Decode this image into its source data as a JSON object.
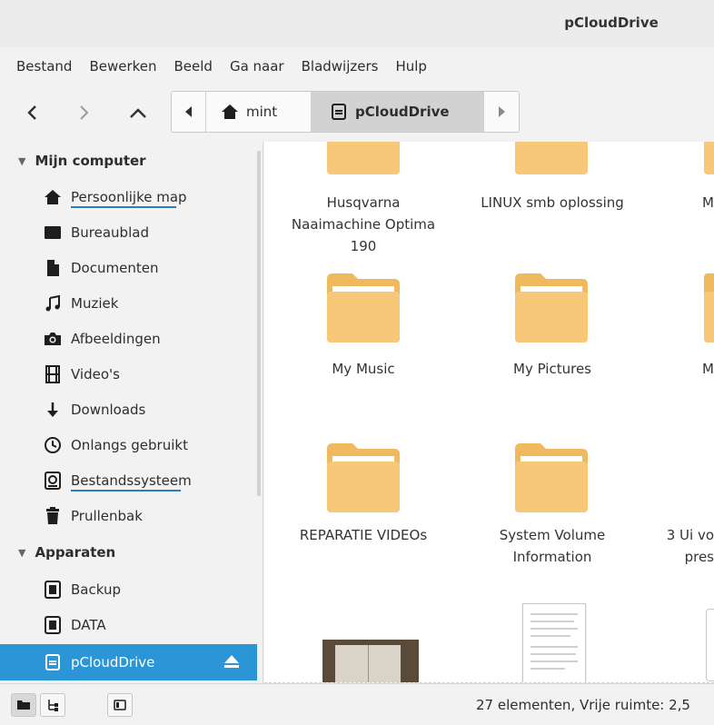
{
  "window": {
    "title": "pCloudDrive"
  },
  "menu": [
    "Bestand",
    "Bewerken",
    "Beeld",
    "Ga naar",
    "Bladwijzers",
    "Hulp"
  ],
  "path": {
    "home": "mint",
    "current": "pCloudDrive"
  },
  "sidebar": {
    "section_computer": "Mijn computer",
    "computer_items": [
      "Persoonlijke map",
      "Bureaublad",
      "Documenten",
      "Muziek",
      "Afbeeldingen",
      "Video's",
      "Downloads",
      "Onlangs gebruikt",
      "Bestandssysteem",
      "Prullenbak"
    ],
    "section_devices": "Apparaten",
    "device_items": [
      "Backup",
      "DATA",
      "pCloudDrive"
    ]
  },
  "files": {
    "row1": [
      "Husqvarna Naaimachine Optima 190",
      "LINUX smb oplossing",
      "M"
    ],
    "row2": [
      "My Music",
      "My Pictures",
      "M"
    ],
    "row3": [
      "REPARATIE VIDEOs",
      "System Volume Information",
      "3 Ui vo pres"
    ]
  },
  "status": {
    "text": "27 elementen, Vrije ruimte: 2,5"
  },
  "colors": {
    "accent": "#2b95d6",
    "folder": "#f6c877",
    "folder_tab": "#f0b95e"
  }
}
